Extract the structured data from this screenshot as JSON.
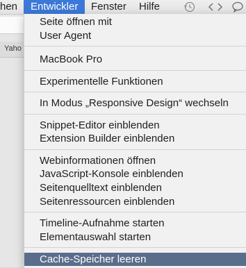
{
  "menubar": {
    "items": [
      {
        "label": "hen",
        "active": false
      },
      {
        "label": "Entwickler",
        "active": true
      },
      {
        "label": "Fenster",
        "active": false
      },
      {
        "label": "Hilfe",
        "active": false
      }
    ],
    "icons": [
      "history-icon",
      "code-brackets-icon",
      "speech-bubble-icon"
    ]
  },
  "background": {
    "tab_label": "Yaho"
  },
  "menu": {
    "groups": [
      [
        "Seite öffnen mit",
        "User Agent"
      ],
      [
        "MacBook Pro"
      ],
      [
        "Experimentelle Funktionen"
      ],
      [
        "In Modus „Responsive Design“ wechseln"
      ],
      [
        "Snippet-Editor einblenden",
        "Extension Builder einblenden"
      ],
      [
        "Webinformationen öffnen",
        "JavaScript-Konsole einblenden",
        "Seitenquelltext einblenden",
        "Seitenressourcen einblenden"
      ],
      [
        "Timeline-Aufnahme starten",
        "Elementauswahl starten"
      ],
      [
        "Cache-Speicher leeren"
      ]
    ],
    "highlighted": "Cache-Speicher leeren"
  }
}
